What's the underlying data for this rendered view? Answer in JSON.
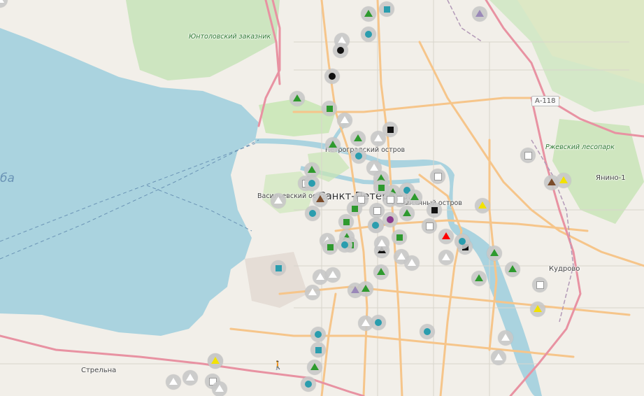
{
  "labels": {
    "city": "Санкт-Петербург",
    "petrogradsky": "Петроградский остров",
    "vasilevsky": "Васильевский остров",
    "bezymyanny": "Безымянный остров",
    "kudrovo": "Кудрово",
    "yanino": "Янино-1",
    "strelna": "Стрельна",
    "yuntolovsky": "Юнтоловский заказник",
    "rzhevsky": "Ржевский лесопарк",
    "sea": "ба",
    "road_shield": "А-118"
  },
  "colors": {
    "water": "#aad3df",
    "land": "#f2efe9",
    "park": "#c8e6b4",
    "major_road": "#f7c98f",
    "trunk": "#e892a2",
    "green_marker": "#2e9a2e",
    "teal_marker": "#2a9dae",
    "purple_marker": "#8b3a8e"
  },
  "markers": [
    {
      "shape": "tri",
      "color": "#2e9a2e"
    },
    {
      "shape": "sq",
      "color": "#2a9dae"
    },
    {
      "shape": "tri",
      "color": "#9a88b8"
    },
    {
      "shape": "ci",
      "color": "#2a9dae"
    },
    {
      "shape": "tri",
      "color": "#ffffff"
    },
    {
      "shape": "ci",
      "color": "#111111"
    },
    {
      "shape": "ci",
      "color": "#111111"
    },
    {
      "shape": "tri",
      "color": "#2e9a2e"
    },
    {
      "shape": "sq",
      "color": "#2e9a2e"
    },
    {
      "shape": "tri",
      "color": "#ffffff"
    },
    {
      "shape": "sq",
      "color": "#111111"
    },
    {
      "shape": "tri",
      "color": "#2e9a2e"
    },
    {
      "shape": "tri",
      "color": "#ffffff"
    },
    {
      "shape": "tri",
      "color": "#2e9a2e"
    },
    {
      "shape": "ci",
      "color": "#2a9dae"
    },
    {
      "shape": "tri",
      "color": "#ffffff"
    },
    {
      "shape": "tri",
      "color": "#2e9a2e"
    },
    {
      "shape": "sq",
      "color": "#ffffff"
    },
    {
      "shape": "ci",
      "color": "#2a9dae"
    },
    {
      "shape": "sq",
      "color": "#2e9a2e"
    },
    {
      "shape": "tri",
      "color": "#2e9a2e"
    },
    {
      "shape": "tri",
      "color": "#ffffff"
    },
    {
      "shape": "sq",
      "color": "#ffffff"
    },
    {
      "shape": "sq",
      "color": "#ffffff"
    },
    {
      "shape": "tri",
      "color": "#7a4b2a"
    },
    {
      "shape": "tri",
      "color": "#2e9a2e"
    },
    {
      "shape": "sq",
      "color": "#2e9a2e"
    },
    {
      "shape": "sq",
      "color": "#ffffff"
    },
    {
      "shape": "ci",
      "color": "#2a9dae"
    },
    {
      "shape": "tri",
      "color": "#2e9a2e"
    },
    {
      "shape": "sq",
      "color": "#ffffff"
    },
    {
      "shape": "ci",
      "color": "#2a9dae"
    },
    {
      "shape": "sq",
      "color": "#ffffff"
    },
    {
      "shape": "sq",
      "color": "#111111"
    },
    {
      "shape": "ci",
      "color": "#2a9dae"
    },
    {
      "shape": "sq",
      "color": "#2e9a2e"
    },
    {
      "shape": "ci",
      "color": "#8b3a8e"
    },
    {
      "shape": "tri",
      "color": "#2e9a2e"
    },
    {
      "shape": "sq",
      "color": "#ffffff"
    },
    {
      "shape": "sq",
      "color": "#2e9a2e"
    },
    {
      "shape": "ci",
      "color": "#2a9dae"
    },
    {
      "shape": "sq",
      "color": "#2e9a2e"
    },
    {
      "shape": "tri",
      "color": "#ffffff"
    },
    {
      "shape": "tri",
      "color": "#2e9a2e"
    },
    {
      "shape": "tri",
      "color": "#111111"
    },
    {
      "shape": "sq",
      "color": "#2e9a2e"
    },
    {
      "shape": "tri",
      "color": "#ffffff"
    },
    {
      "shape": "sq",
      "color": "#2e9a2e"
    },
    {
      "shape": "ci",
      "color": "#2a9dae"
    },
    {
      "shape": "tri",
      "color": "#ff0000"
    },
    {
      "shape": "sq",
      "color": "#111111"
    },
    {
      "shape": "tri",
      "color": "#ffffff"
    },
    {
      "shape": "ci",
      "color": "#2a9dae"
    },
    {
      "shape": "tri",
      "color": "#2e9a2e"
    },
    {
      "shape": "tri",
      "color": "#2e9a2e"
    },
    {
      "shape": "tri",
      "color": "#2e9a2e"
    },
    {
      "shape": "tri",
      "color": "#ffffff"
    },
    {
      "shape": "tri",
      "color": "#ffffff"
    },
    {
      "shape": "tri",
      "color": "#f2e200"
    },
    {
      "shape": "sq",
      "color": "#ffffff"
    },
    {
      "shape": "tri",
      "color": "#7a4b2a"
    },
    {
      "shape": "tri",
      "color": "#f2e200"
    },
    {
      "shape": "tri",
      "color": "#f2e200"
    },
    {
      "shape": "sq",
      "color": "#ffffff"
    },
    {
      "shape": "tri",
      "color": "#f2e200"
    },
    {
      "shape": "sq",
      "color": "#2a9dae"
    },
    {
      "shape": "tri",
      "color": "#ffffff"
    },
    {
      "shape": "tri",
      "color": "#ffffff"
    },
    {
      "shape": "tri",
      "color": "#9a88b8"
    },
    {
      "shape": "tri",
      "color": "#2e9a2e"
    },
    {
      "shape": "tri",
      "color": "#2e9a2e"
    },
    {
      "shape": "tri",
      "color": "#ffffff"
    },
    {
      "shape": "ci",
      "color": "#2a9dae"
    },
    {
      "shape": "tri",
      "color": "#ffffff"
    },
    {
      "shape": "ci",
      "color": "#2a9dae"
    },
    {
      "shape": "ci",
      "color": "#2a9dae"
    },
    {
      "shape": "tri",
      "color": "#ffffff"
    },
    {
      "shape": "tri",
      "color": "#ffffff"
    },
    {
      "shape": "sq",
      "color": "#2a9dae"
    },
    {
      "shape": "tri",
      "color": "#2e9a2e"
    },
    {
      "shape": "ci",
      "color": "#2a9dae"
    },
    {
      "shape": "tri",
      "color": "#f2e200"
    },
    {
      "shape": "tri",
      "color": "#ffffff"
    },
    {
      "shape": "tri",
      "color": "#ffffff"
    },
    {
      "shape": "sq",
      "color": "#ffffff"
    },
    {
      "shape": "tri",
      "color": "#ffffff"
    },
    {
      "shape": "tri",
      "color": "#ffffff"
    }
  ]
}
